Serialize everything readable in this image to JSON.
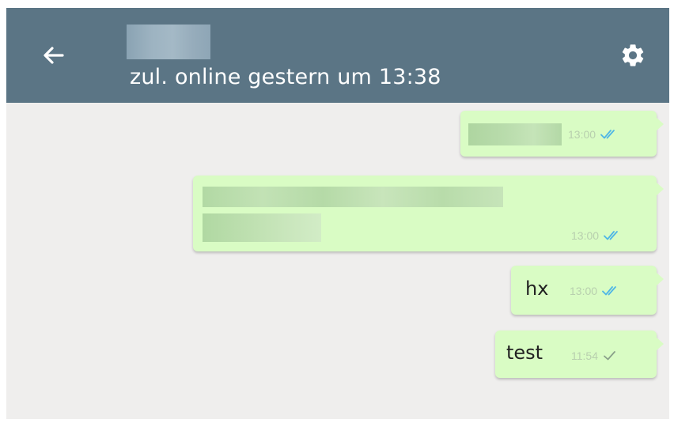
{
  "header": {
    "status": "zul. online gestern um 13:38",
    "back_icon": "arrow-left-icon",
    "settings_icon": "gear-icon"
  },
  "messages": [
    {
      "text": "",
      "time": "13:00",
      "receipt": "double-check-icon",
      "receipt_color": "#4fb6e6",
      "redacted": true
    },
    {
      "text": "",
      "time": "13:00",
      "receipt": "double-check-icon",
      "receipt_color": "#4fb6e6",
      "redacted": true
    },
    {
      "text": "hx",
      "time": "13:00",
      "receipt": "double-check-icon",
      "receipt_color": "#4fb6e6",
      "redacted": false
    },
    {
      "text": "test",
      "time": "11:54",
      "receipt": "single-check-icon",
      "receipt_color": "#8aa08a",
      "redacted": false
    }
  ],
  "colors": {
    "appbar": "#5b7585",
    "chat_background": "#efeeed",
    "outgoing_bubble": "#d9fcc4"
  }
}
